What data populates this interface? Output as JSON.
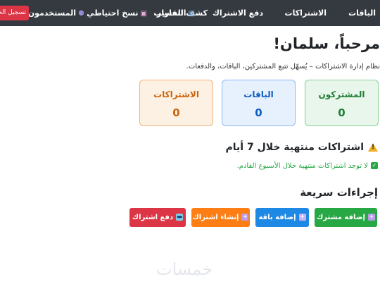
{
  "navbar": {
    "items": [
      {
        "label": "الباقات",
        "icon": null
      },
      {
        "label": "الاشتراكات",
        "icon": null
      },
      {
        "label": "دفع الاشتراك",
        "icon": null
      },
      {
        "label": "كشف الحساب",
        "icon": null
      },
      {
        "label": "التقارير",
        "icon": "chart-icon"
      },
      {
        "label": "نسخ احتياطي",
        "icon": "floppy-disk-icon"
      },
      {
        "label": "المستخدمون",
        "icon": "users-icon"
      }
    ],
    "logout_label": "تسجيل الخروج"
  },
  "welcome": "مرحباً، سلمان!",
  "subtitle": "نظام إدارة الاشتراكات – يُسهّل تتبع المشتركين، الباقات، والدفعات.",
  "stats": [
    {
      "label": "المشتركون",
      "value": "0",
      "color": "#1e7e34"
    },
    {
      "label": "الباقات",
      "value": "0",
      "color": "#0d5bbf"
    },
    {
      "label": "الاشتراكات",
      "value": "0",
      "color": "#c7650f"
    }
  ],
  "expiring": {
    "title": "اشتراكات منتهية خلال 7 أيام",
    "icon": "warning-icon",
    "empty_message": "لا توجد اشتراكات منتهية خلال الأسبوع القادم."
  },
  "quick_actions": {
    "title": "إجراءات سريعة",
    "buttons": [
      {
        "label": "إضافة مشترك",
        "icon": "plus-icon",
        "color": "#28a745"
      },
      {
        "label": "إضافة باقة",
        "icon": "plus-icon",
        "color": "#1e88e5"
      },
      {
        "label": "إنشاء اشتراك",
        "icon": "plus-icon",
        "color": "#fd7e14"
      },
      {
        "label": "دفع اشتراك",
        "icon": "credit-card-icon",
        "color": "#dc3545"
      }
    ]
  },
  "watermark": "خمسات"
}
